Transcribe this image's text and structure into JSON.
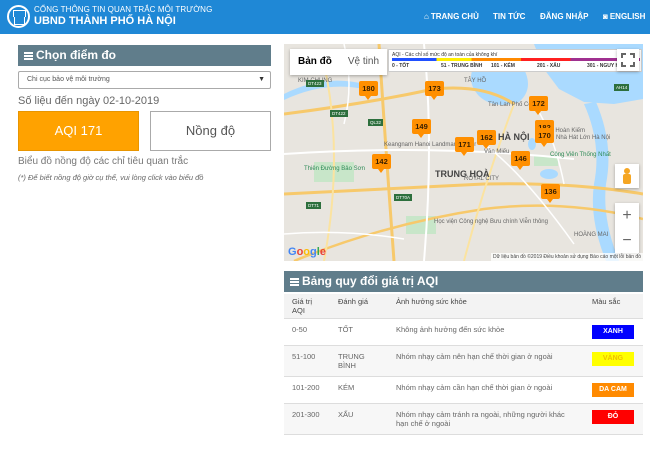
{
  "header": {
    "brand_top": "CỔNG THÔNG TIN QUAN TRẮC MÔI TRƯỜNG",
    "brand_main": "UBND THÀNH PHỐ HÀ NỘI",
    "nav": [
      {
        "label": "TRANG CHỦ",
        "icon": "home-icon"
      },
      {
        "label": "TIN TỨC"
      },
      {
        "label": "ĐĂNG NHẬP"
      },
      {
        "label": "ENGLISH",
        "icon": "globe-icon"
      }
    ]
  },
  "left": {
    "section_title": "Chọn điểm đo",
    "select_value": "Chi cục bảo vệ môi trường",
    "date_label": "Số liệu đến ngày 02-10-2019",
    "tab_aqi": "AQI 171",
    "tab_concentration": "Nồng độ",
    "hint": "Biểu đồ nồng độ các chỉ tiêu quan trắc",
    "hint_note": "(*) Để biết nồng độ giờ cụ thể, vui lòng click vào biểu đồ"
  },
  "map": {
    "tab_map": "Bản đồ",
    "tab_satellite": "Vệ tinh",
    "legend_title": "AQI - Các chỉ số mức độ an toàn của không khí",
    "legend_levels": [
      "0 - TỐT",
      "51 - TRUNG BÌNH",
      "101 - KÉM",
      "201 - XẤU",
      "301 - NGUY HẠI"
    ],
    "markers": [
      "180",
      "173",
      "172",
      "149",
      "182",
      "171",
      "162",
      "170",
      "146",
      "142",
      "136"
    ],
    "labels": {
      "ha_noi": "HÀ NỘI",
      "trung_hoa": "TRUNG HOÀ",
      "tan_lan": "Tân Lan Phố Cổ",
      "hoan_kiem": "Hồ Hoàn Kiếm",
      "nha_hat_lon": "Nhà Hát Lớn Hà Nội",
      "van_mieu": "Văn Miếu",
      "keangnam": "Keangnam Hanoi Landmark Tower",
      "thien_duong": "Thiên Đường Bảo Sơn",
      "cong_vien_thong_nhat": "Công Viên Thống Nhất",
      "hoc_vien": "Học viện Công nghệ Bưu chính Viễn thông",
      "kim_chung": "KIM CHUNG",
      "tay_ho": "TÂY HỒ",
      "hoang_mai": "HOÀNG MAI",
      "royal_city": "ROYAL CITY"
    },
    "road_badges": [
      "DT423",
      "DT422",
      "QL32",
      "AH14",
      "DT71",
      "DT70A"
    ],
    "google": "Google",
    "footer": "Dữ liệu bản đồ ©2019   Điều khoản sử dụng   Báo cáo một lỗi bản đồ",
    "zoom_in": "+",
    "zoom_out": "−"
  },
  "aqi_table": {
    "section_title": "Bảng quy đổi giá trị AQI",
    "headers": [
      "Giá trị AQI",
      "Đánh giá",
      "Ảnh hưởng sức khỏe",
      "Màu sắc"
    ],
    "rows": [
      {
        "range": "0-50",
        "rating": "TỐT",
        "effect": "Không ảnh hưởng đến sức khỏe",
        "color_label": "XANH",
        "color": "#0000ff",
        "text_color": "#ffffff"
      },
      {
        "range": "51-100",
        "rating": "TRUNG BÌNH",
        "effect": "Nhóm nhạy cảm nên hạn chế thời gian ở ngoài",
        "color_label": "VÀNG",
        "color": "#ffff00",
        "text_color": "#f0c000"
      },
      {
        "range": "101-200",
        "rating": "KÉM",
        "effect": "Nhóm nhạy cảm cần hạn chế thời gian ở ngoài",
        "color_label": "DA CAM",
        "color": "#ff8a00",
        "text_color": "#ffffff"
      },
      {
        "range": "201-300",
        "rating": "XẤU",
        "effect": "Nhóm nhạy cảm tránh ra ngoài, những người khác hạn chế ở ngoài",
        "color_label": "ĐỎ",
        "color": "#ff0000",
        "text_color": "#ffffff"
      }
    ]
  }
}
